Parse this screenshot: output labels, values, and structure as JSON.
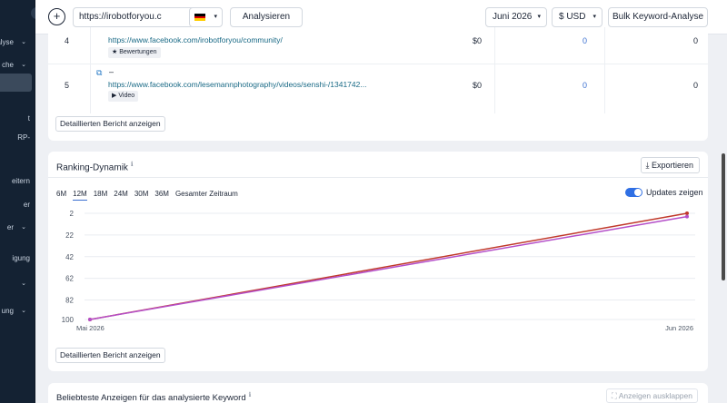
{
  "sidebar": {
    "items": [
      {
        "label": "alyse",
        "chevron": true
      },
      {
        "label": "che",
        "chevron": true
      },
      {
        "label": "t",
        "chevron": false
      },
      {
        "label": "RP-",
        "chevron": false
      },
      {
        "label": "eitern",
        "chevron": false
      },
      {
        "label": "er",
        "chevron": false
      },
      {
        "label": "er",
        "chevron": true
      },
      {
        "label": "igung",
        "chevron": false
      },
      {
        "label": "",
        "chevron": true
      },
      {
        "label": "ung",
        "chevron": true
      }
    ],
    "collapse_icon": "‹"
  },
  "topbar": {
    "url_value": "https://irobotforyou.c",
    "analyze_label": "Analysieren",
    "month_label": "Juni 2026",
    "currency_label": "$ USD",
    "bulk_label": "Bulk Keyword-Analyse",
    "flag_colors": [
      "#000000",
      "#dd0000",
      "#ffce00"
    ]
  },
  "table": {
    "rows": [
      {
        "index": "4",
        "url": "https://www.facebook.com/irobotforyou/community/",
        "tag": "Bewertungen",
        "tag_icon": "star-icon",
        "cost": "$0",
        "col2": "0",
        "col3": "0"
      },
      {
        "index": "5",
        "url": "https://www.facebook.com/lesemannphotography/videos/senshi-/1341742...",
        "title": "–",
        "tag": "Video",
        "tag_icon": "video-icon",
        "cost": "$0",
        "col2": "0",
        "col3": "0"
      }
    ],
    "detail_button": "Detaillierten Bericht anzeigen"
  },
  "ranking": {
    "title": "Ranking-Dynamik",
    "export_label": "Exportieren",
    "periods": [
      "6M",
      "12M",
      "18M",
      "24M",
      "30M",
      "36M",
      "Gesamter Zeitraum"
    ],
    "active_period": "12M",
    "toggle_label": "Updates zeigen",
    "detail_button": "Detaillierten Bericht anzeigen"
  },
  "ads": {
    "title": "Beliebteste Anzeigen für das analysierte Keyword",
    "expand_label": "Anzeigen ausklappen"
  },
  "chart_data": {
    "type": "line",
    "x": [
      "Mai 2026",
      "Jun 2026"
    ],
    "y_ticks": [
      2,
      22,
      42,
      62,
      82,
      100
    ],
    "ylim": [
      100,
      2
    ],
    "y_inverted": true,
    "grid": true,
    "series": [
      {
        "values": [
          100,
          2
        ],
        "color": "#c0392b"
      },
      {
        "values": [
          100,
          5
        ],
        "color": "#b44fc9"
      }
    ]
  }
}
